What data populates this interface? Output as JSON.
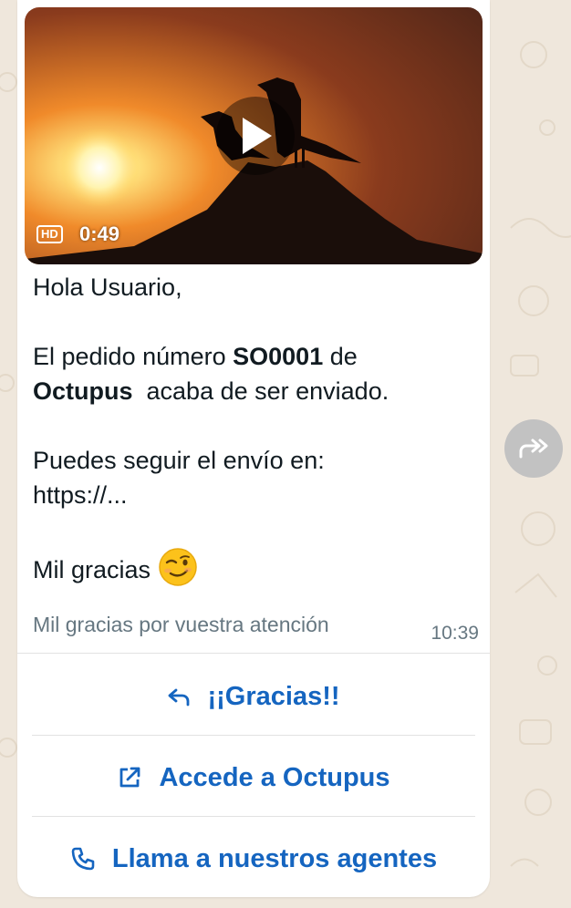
{
  "video": {
    "duration": "0:49",
    "hd_label": "HD"
  },
  "message": {
    "greeting": "Hola Usuario,",
    "line1_prefix": "El pedido número ",
    "order_number": "SO0001",
    "line1_suffix": " de",
    "company": "Octupus",
    "line2_suffix": "  acaba de ser enviado.",
    "tracking_intro": "Puedes seguir el envío en:",
    "tracking_link": "https://...",
    "thanks": "Mil gracias",
    "emoji": "winking-smile-emoji"
  },
  "footer": {
    "text": "Mil gracias por vuestra atención",
    "time": "10:39"
  },
  "actions": [
    {
      "label": "¡¡Gracias!!",
      "icon": "reply-icon"
    },
    {
      "label": "Accede a Octupus",
      "icon": "external-link-icon"
    },
    {
      "label": "Llama a nuestros agentes",
      "icon": "phone-icon"
    }
  ],
  "colors": {
    "action": "#1565c0",
    "background": "#efe7dc",
    "meta_text": "#667781"
  }
}
